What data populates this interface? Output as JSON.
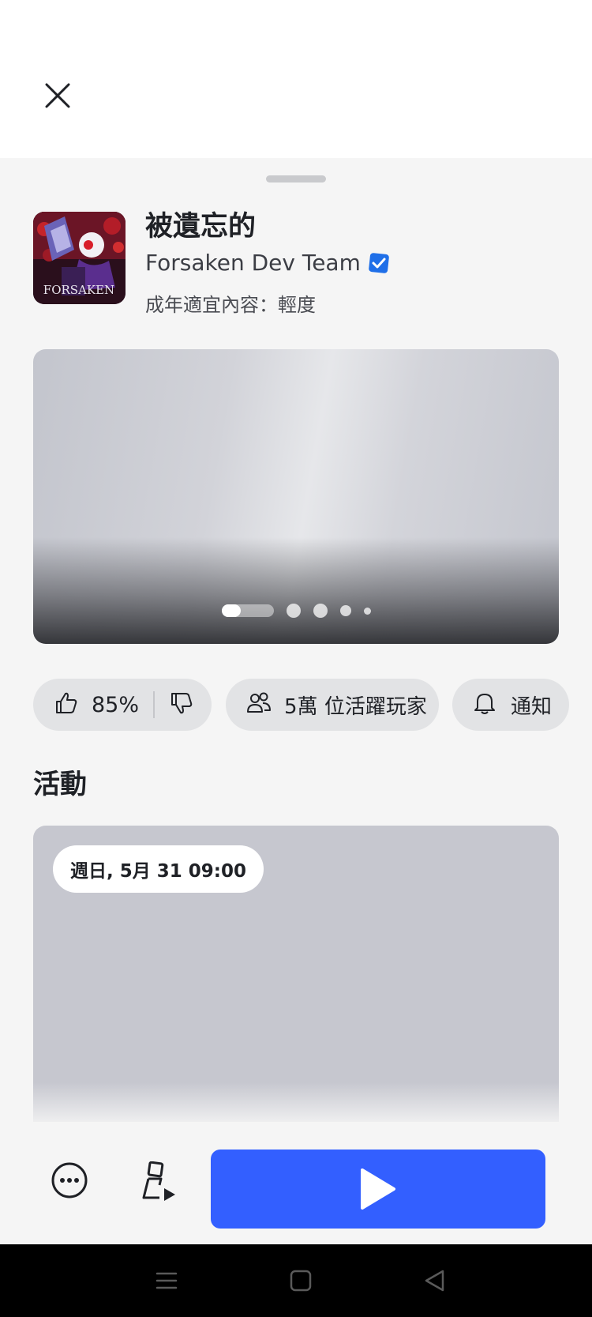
{
  "header": {
    "close_icon": "close-icon"
  },
  "game": {
    "title": "被遺忘的",
    "creator": "Forsaken Dev Team",
    "verified": true,
    "maturity": "成年適宜內容：輕度",
    "icon_text": "FORSAKEN"
  },
  "carousel": {
    "slide_count": 5,
    "active_index": 0
  },
  "stats": {
    "vote_percent": "85%",
    "active_players_count": "5萬",
    "active_players_label": "位活躍玩家",
    "notify_label": "通知"
  },
  "events": {
    "section_title": "活動",
    "items": [
      {
        "date": "週日, 5月 31 09:00"
      }
    ]
  },
  "actions": {
    "more_icon": "more-icon",
    "avatar_icon": "avatar-play-icon",
    "play_icon": "play-icon"
  },
  "colors": {
    "accent": "#335fff",
    "verified": "#1f6fe8",
    "sheet_bg": "#f5f5f5"
  }
}
